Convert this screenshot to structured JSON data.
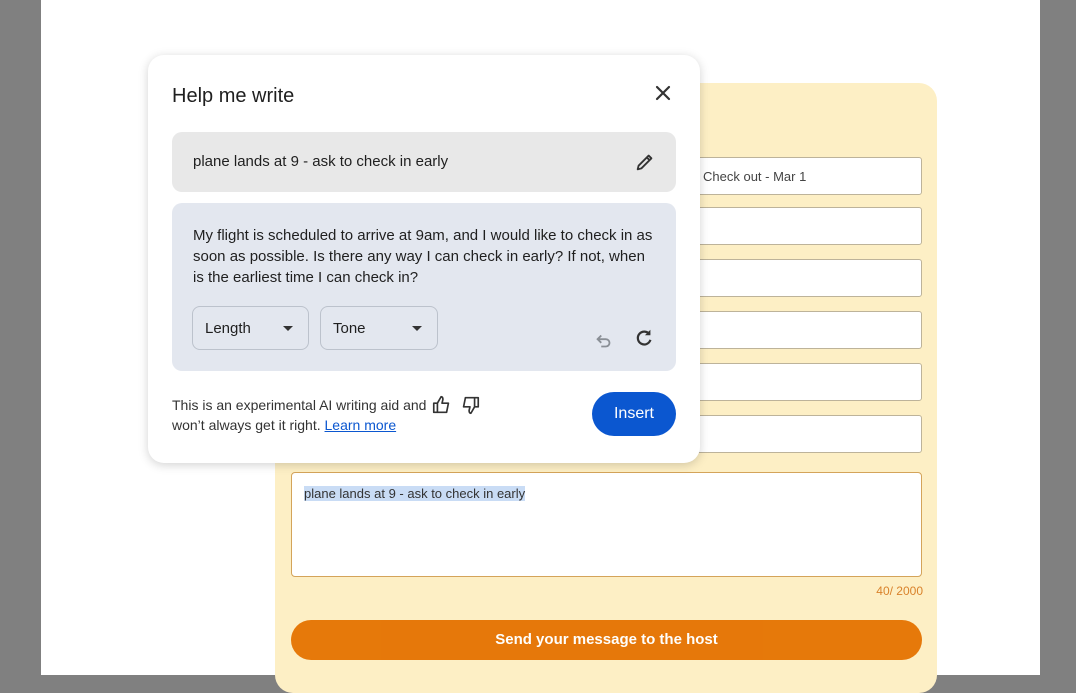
{
  "form": {
    "fields": [
      "Check out - Mar 1",
      "",
      "",
      "",
      "",
      ""
    ],
    "message": "plane lands at 9 - ask to check in early",
    "counter": "40/ 2000",
    "send_label": "Send your message to the host"
  },
  "dialog": {
    "title": "Help me write",
    "prompt": "plane lands at 9 - ask to check in early",
    "response": "My flight is scheduled to arrive at 9am, and I would like to check in as soon as possible. Is there any way I can check in early? If not, when is the earliest time I can check in?",
    "length_label": "Length",
    "tone_label": "Tone",
    "disclaimer": "This is an experimental AI writing aid and won’t always get it right.",
    "learn_more": "Learn more",
    "insert_label": "Insert",
    "accent_color": "#0b57d0"
  }
}
